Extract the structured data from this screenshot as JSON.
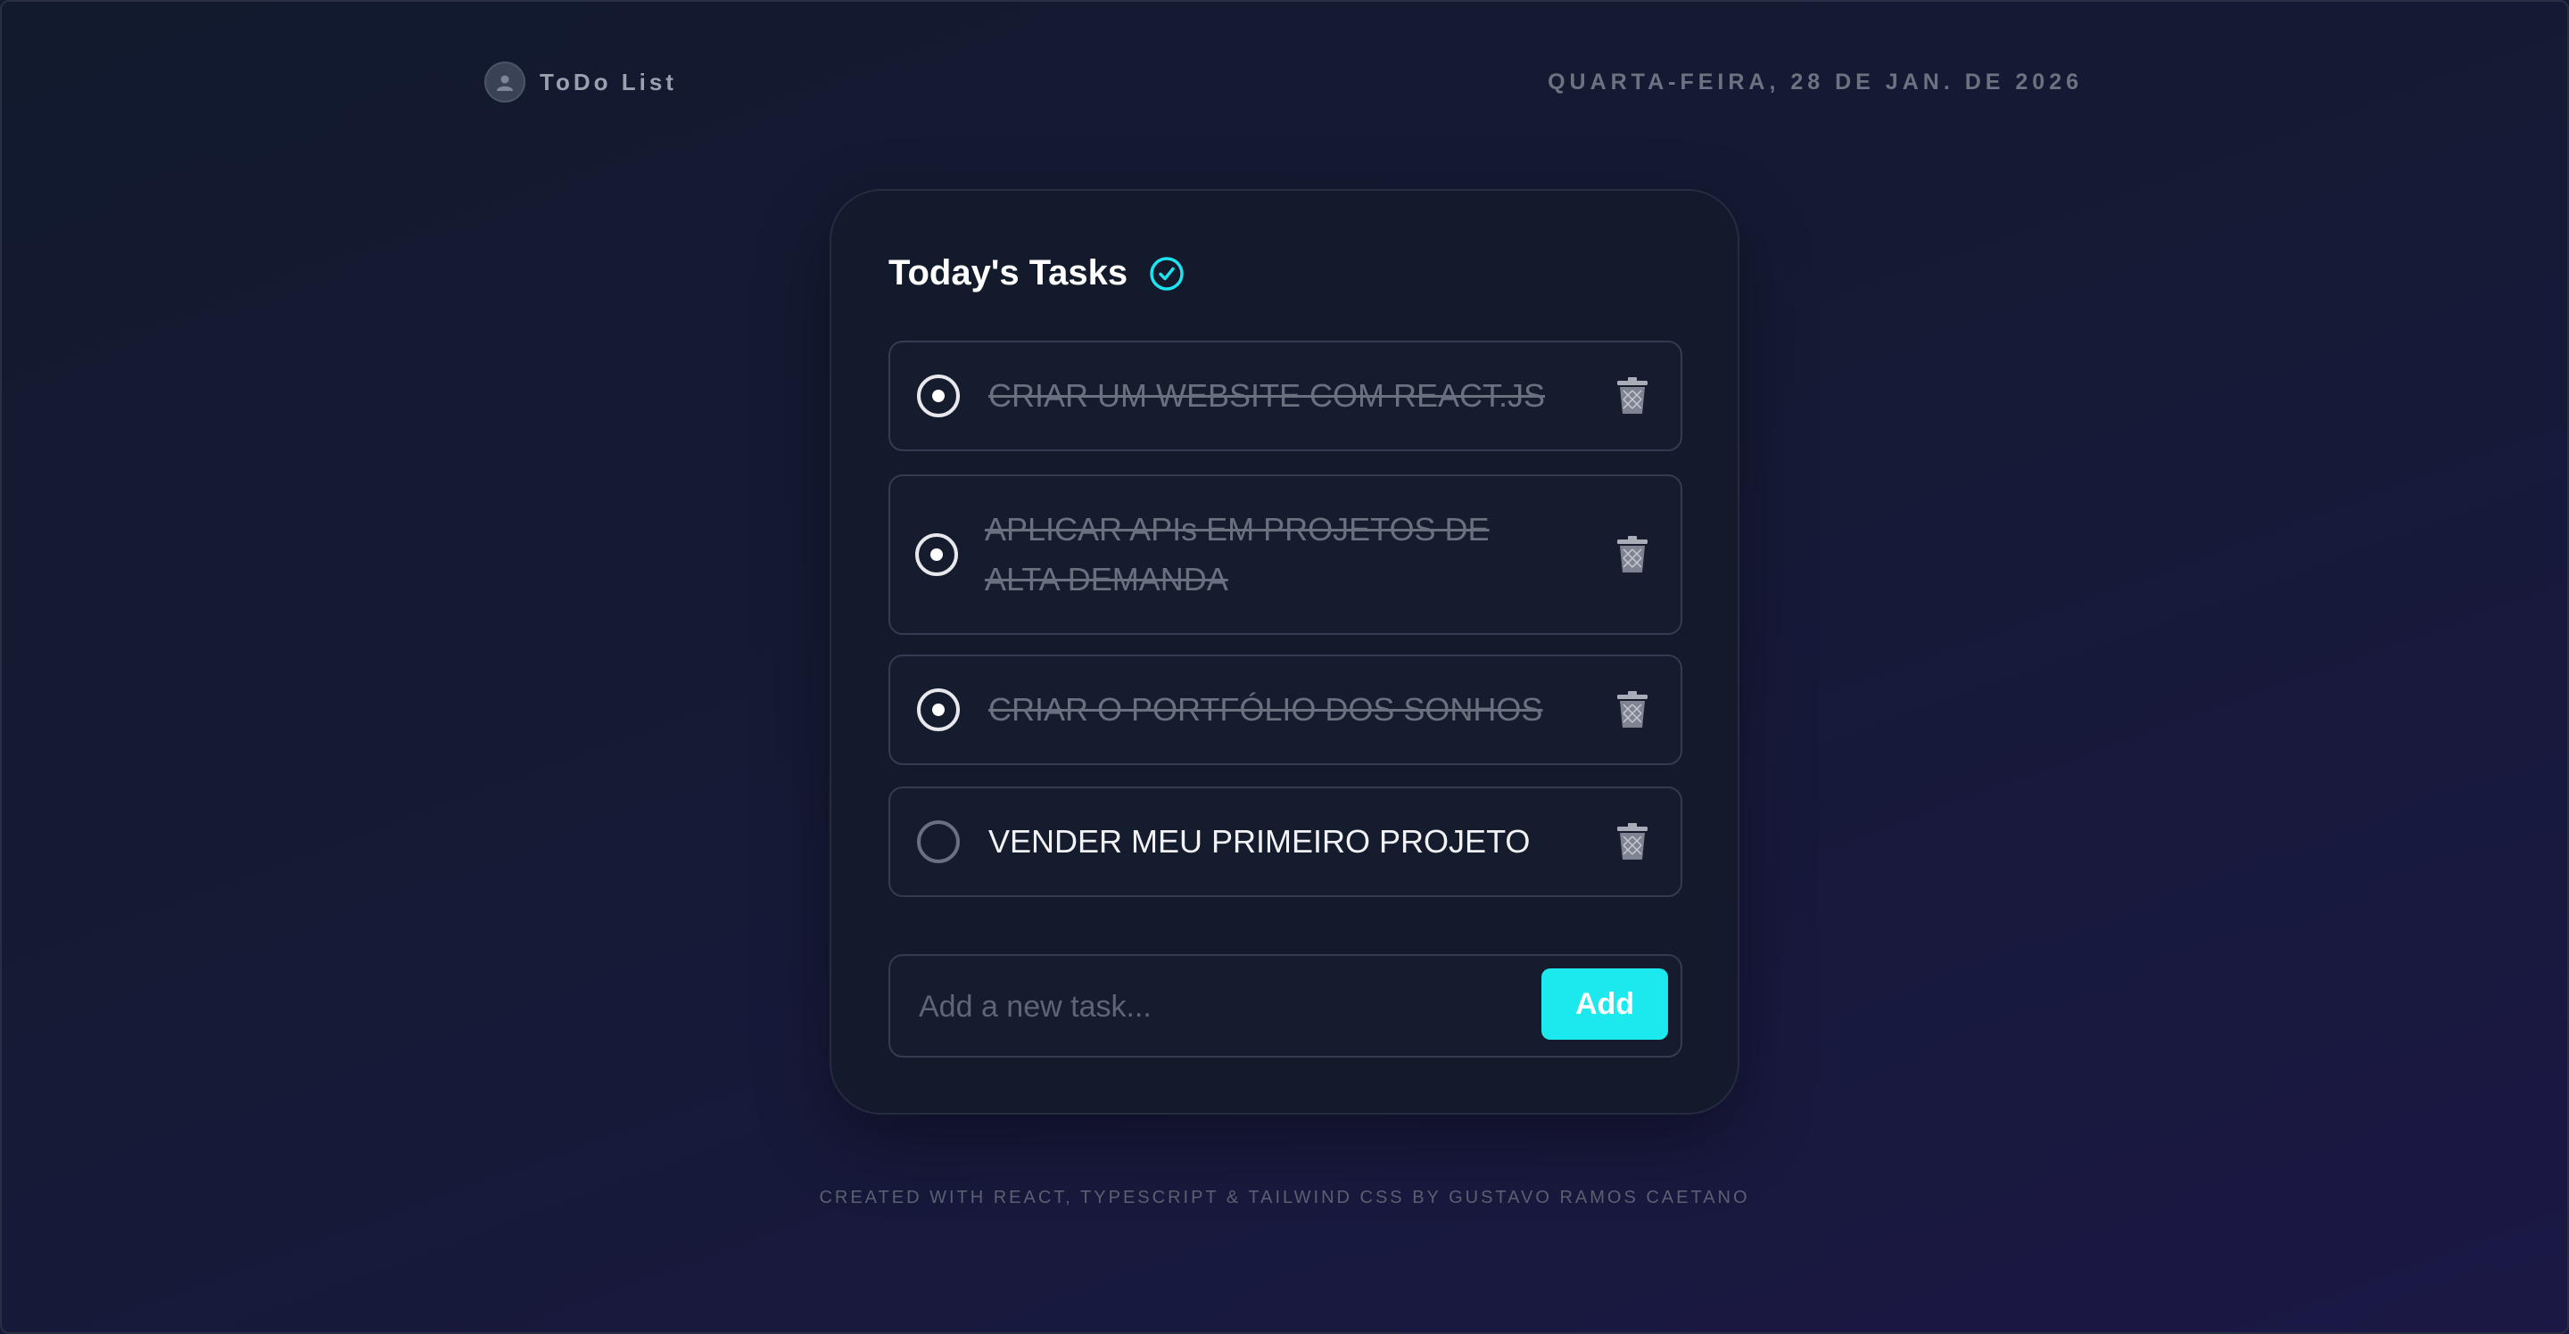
{
  "header": {
    "app_title": "ToDo List",
    "date": "QUARTA-FEIRA, 28 DE JAN. DE 2026",
    "avatar_icon": "user-icon"
  },
  "card": {
    "title": "Today's Tasks",
    "title_icon": "check-circle-icon"
  },
  "tasks": [
    {
      "text": "CRIAR UM WEBSITE COM REACT.JS",
      "completed": true
    },
    {
      "text": "APLICAR APIs EM PROJETOS DE ALTA DEMANDA",
      "completed": true
    },
    {
      "text": "CRIAR O PORTFÓLIO DOS SONHOS",
      "completed": true
    },
    {
      "text": "VENDER MEU PRIMEIRO PROJETO",
      "completed": false
    }
  ],
  "add_form": {
    "placeholder": "Add a new task...",
    "value": "",
    "button_label": "Add"
  },
  "footer": {
    "text": "CREATED WITH REACT, TYPESCRIPT & TAILWIND CSS BY GUSTAVO RAMOS CAETANO"
  },
  "colors": {
    "accent": "#1be9ee",
    "card_bg": "#131a2c",
    "completed_text": "#6a707e"
  }
}
